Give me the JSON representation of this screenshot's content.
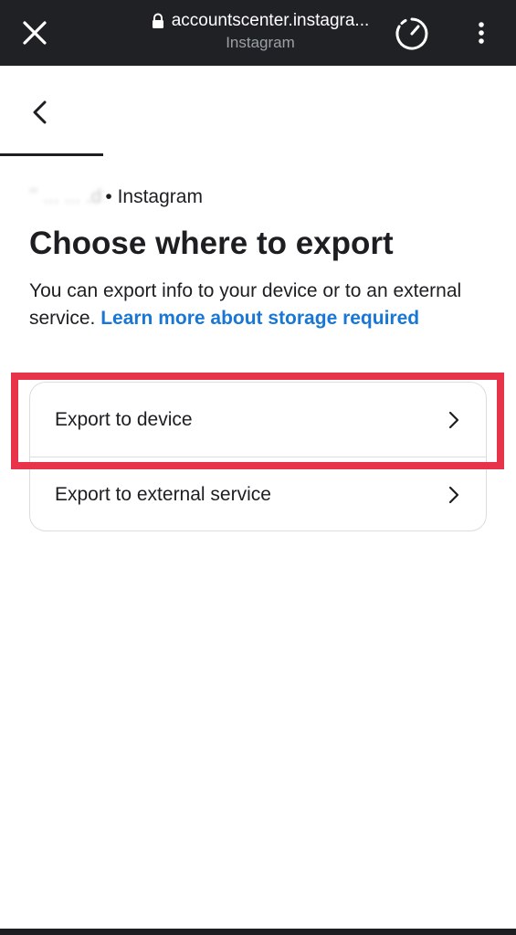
{
  "browser": {
    "url": "accountscenter.instagra...",
    "site_name": "Instagram"
  },
  "account": {
    "name": "ʼʼ           ...  ...  .d",
    "separator": "•",
    "platform": "Instagram"
  },
  "page": {
    "title": "Choose where to export",
    "description_prefix": "You can export info to your device or to an external service. ",
    "learn_more_link": "Learn more about storage required"
  },
  "options": [
    {
      "label": "Export to device",
      "highlighted": true
    },
    {
      "label": "Export to external service",
      "highlighted": false
    }
  ],
  "colors": {
    "top_bar": "#202124",
    "link": "#1877d5",
    "highlight": "#e8344b",
    "text": "#1c1e21",
    "border": "#dadde1"
  },
  "icons": {
    "close": "close-icon",
    "lock": "lock-icon",
    "speed": "speed-icon",
    "menu": "more-vertical-icon",
    "back": "back-arrow-icon",
    "chevron": "chevron-right-icon"
  }
}
